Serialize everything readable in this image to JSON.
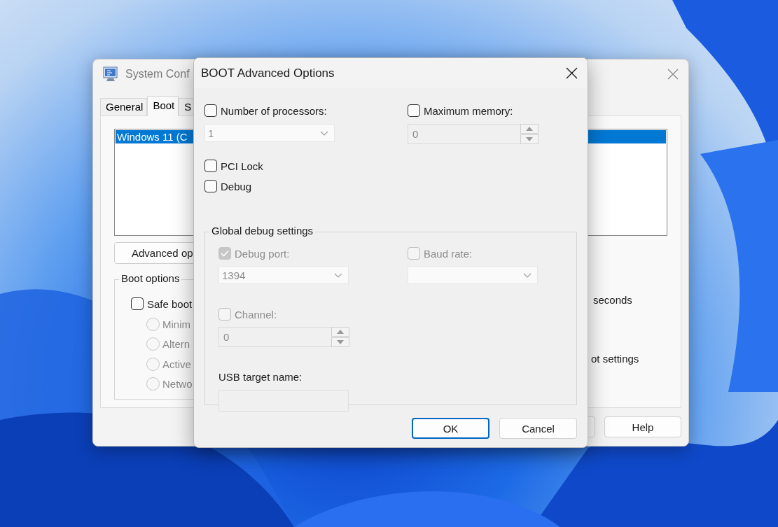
{
  "background_window": {
    "title": "System Conf",
    "tabs": [
      {
        "label": "General",
        "selected": false
      },
      {
        "label": "Boot",
        "selected": true
      },
      {
        "label": "S",
        "selected": false
      }
    ],
    "boot_list": [
      {
        "label": "Windows 11 (C",
        "selected": true
      }
    ],
    "advanced_button": "Advanced op",
    "boot_options": {
      "title": "Boot options",
      "safe_boot": {
        "label": "Safe boot",
        "checked": false
      },
      "radios": [
        {
          "label": "Minim",
          "selected": false,
          "disabled": true
        },
        {
          "label": "Altern",
          "selected": false,
          "disabled": true
        },
        {
          "label": "Active",
          "selected": false,
          "disabled": true
        },
        {
          "label": "Netwo",
          "selected": false,
          "disabled": true
        }
      ]
    },
    "timeout_unit": "seconds",
    "settings_label": "ot settings",
    "buttons": [
      "Help"
    ]
  },
  "dialog": {
    "title": "BOOT Advanced Options",
    "options": [
      {
        "kind": "dropdown",
        "label": "Number of processors:",
        "checked": false,
        "field_disabled": true,
        "value": "1"
      },
      {
        "kind": "spinner",
        "label": "Maximum memory:",
        "checked": false,
        "field_disabled": true,
        "value": "0"
      }
    ],
    "checkboxes": [
      {
        "label": "PCI Lock",
        "checked": false
      },
      {
        "label": "Debug",
        "checked": false
      }
    ],
    "debug_group": {
      "title": "Global debug settings",
      "fields": [
        {
          "kind": "dropdown",
          "label": "Debug port:",
          "checked": true,
          "disabled": true,
          "value": "1394"
        },
        {
          "kind": "dropdown",
          "label": "Baud rate:",
          "checked": false,
          "disabled": true
        },
        {
          "kind": "spinner",
          "label": "Channel:",
          "checked": false,
          "disabled": true,
          "value": "0"
        },
        {
          "kind": "text",
          "label": "USB target name:",
          "disabled": true
        }
      ]
    },
    "buttons": [
      {
        "label": "OK",
        "default": true
      },
      {
        "label": "Cancel",
        "default": false
      }
    ]
  }
}
